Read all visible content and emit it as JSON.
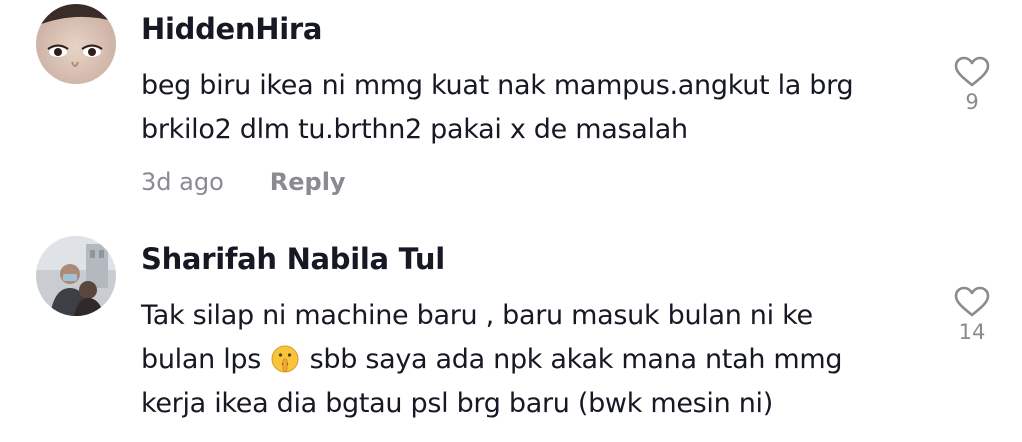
{
  "comments": [
    {
      "username": "HiddenHira",
      "lines": [
        "beg biru ikea ni mmg kuat nak mampus.angkut la brg",
        "brkilo2 dlm tu.brthn2 pakai x de masalah"
      ],
      "time": "3d ago",
      "reply_label": "Reply",
      "likes": "9",
      "avatar_icon": "user-photo-avatar"
    },
    {
      "username": "Sharifah Nabila Tul",
      "lines_before_emoji": [
        "Tak silap ni machine baru , baru masuk bulan ni ke"
      ],
      "line_emoji_prefix": "bulan lps",
      "emoji_icon": "shushing-face-emoji",
      "line_emoji_suffix": "sbb saya ada npk akak mana ntah mmg",
      "lines_after_emoji": [
        "kerja ikea dia bgtau psl brg baru (bwk mesin ni)"
      ],
      "likes": "14",
      "avatar_icon": "user-photo-avatar"
    }
  ],
  "colors": {
    "text": "#161823",
    "meta": "#8a8b91",
    "icon": "#8a8b91"
  }
}
